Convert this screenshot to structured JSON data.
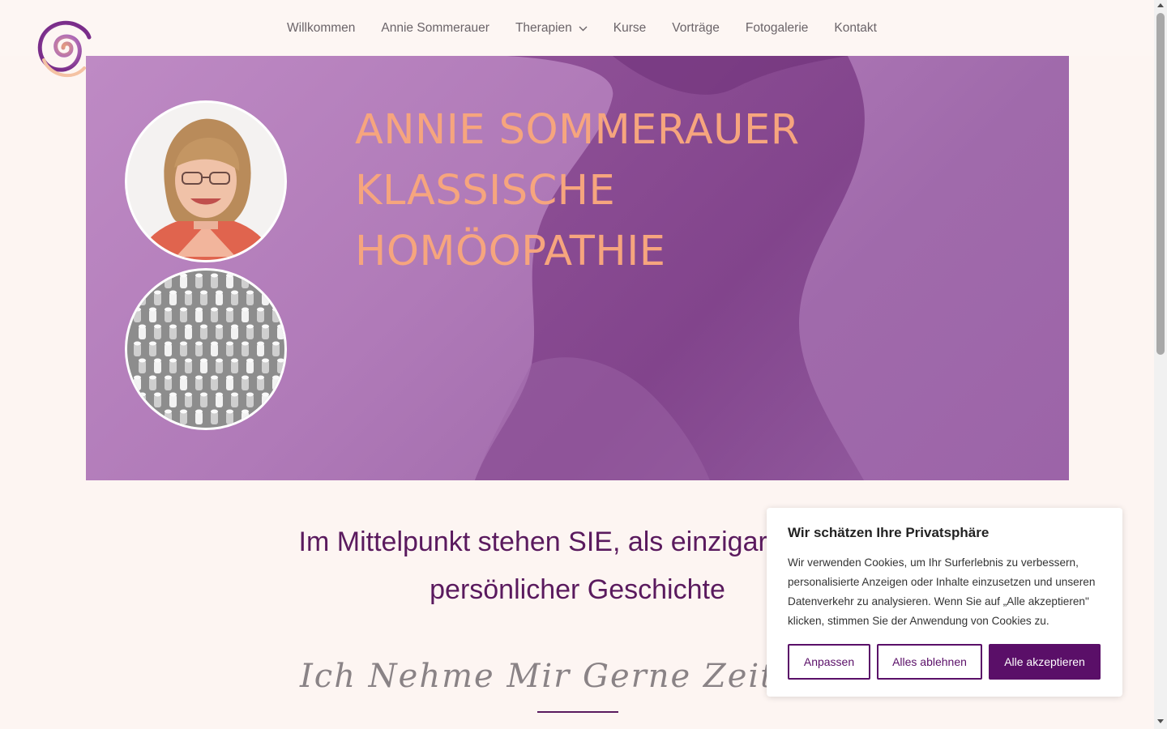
{
  "nav": {
    "items": [
      {
        "label": "Willkommen"
      },
      {
        "label": "Annie Sommerauer"
      },
      {
        "label": "Therapien",
        "has_dropdown": true
      },
      {
        "label": "Kurse"
      },
      {
        "label": "Vorträge"
      },
      {
        "label": "Fotogalerie"
      },
      {
        "label": "Kontakt"
      }
    ]
  },
  "logo": {
    "icon": "spiral-logo-icon"
  },
  "hero": {
    "title_lines": [
      "ANNIE SOMMERAUER",
      "KLASSISCHE",
      "HOMÖOPATHIE"
    ],
    "title_color": "#f6a57e",
    "background_color": "#b07ab8"
  },
  "intro": {
    "line1": "Im Mittelpunkt stehen SIE, als einzigartiges In",
    "line2": "persönlicher Geschichte"
  },
  "script_heading": "Ich Nehme Mir Gerne Zeit Fü",
  "cookie": {
    "title": "Wir schätzen Ihre Privatsphäre",
    "text": "Wir verwenden Cookies, um Ihr Surferlebnis zu verbessern, personalisierte Anzeigen oder Inhalte einzusetzen und unseren Datenverkehr zu analysieren. Wenn Sie auf „Alle akzeptieren\" klicken, stimmen Sie der Anwendung von Cookies zu.",
    "customize_label": "Anpassen",
    "reject_label": "Alles ablehnen",
    "accept_label": "Alle akzeptieren",
    "accent_color": "#5a0f68"
  },
  "colors": {
    "heading": "#5a1a5e",
    "page_background": "#fdf5f2",
    "nav_text": "#6b6469"
  }
}
